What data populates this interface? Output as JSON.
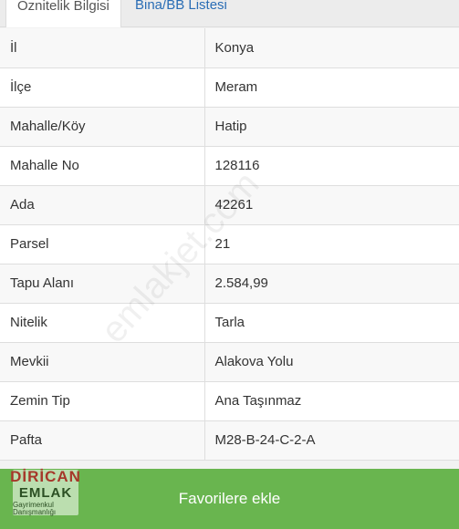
{
  "tabs": [
    {
      "label": "Öznitelik Bilgisi",
      "active": true
    },
    {
      "label": "Bina/BB Listesi",
      "active": false
    }
  ],
  "rows": [
    {
      "key": "İl",
      "value": "Konya"
    },
    {
      "key": "İlçe",
      "value": "Meram"
    },
    {
      "key": "Mahalle/Köy",
      "value": "Hatip"
    },
    {
      "key": "Mahalle No",
      "value": "128116"
    },
    {
      "key": "Ada",
      "value": "42261"
    },
    {
      "key": "Parsel",
      "value": "21"
    },
    {
      "key": "Tapu Alanı",
      "value": "2.584,99"
    },
    {
      "key": "Nitelik",
      "value": "Tarla"
    },
    {
      "key": "Mevkii",
      "value": "Alakova Yolu"
    },
    {
      "key": "Zemin Tip",
      "value": "Ana Taşınmaz"
    },
    {
      "key": "Pafta",
      "value": "M28-B-24-C-2-A"
    }
  ],
  "watermark": "emlakjet.com",
  "favorites_button": {
    "label": "Favorilere ekle"
  },
  "logo": {
    "line1": "DİRİCAN",
    "line2": "EMLAK",
    "line3": "Gayrimenkul Danışmanlığı"
  },
  "colors": {
    "accent_green": "#69b54f",
    "tab_link": "#2a6db5"
  }
}
